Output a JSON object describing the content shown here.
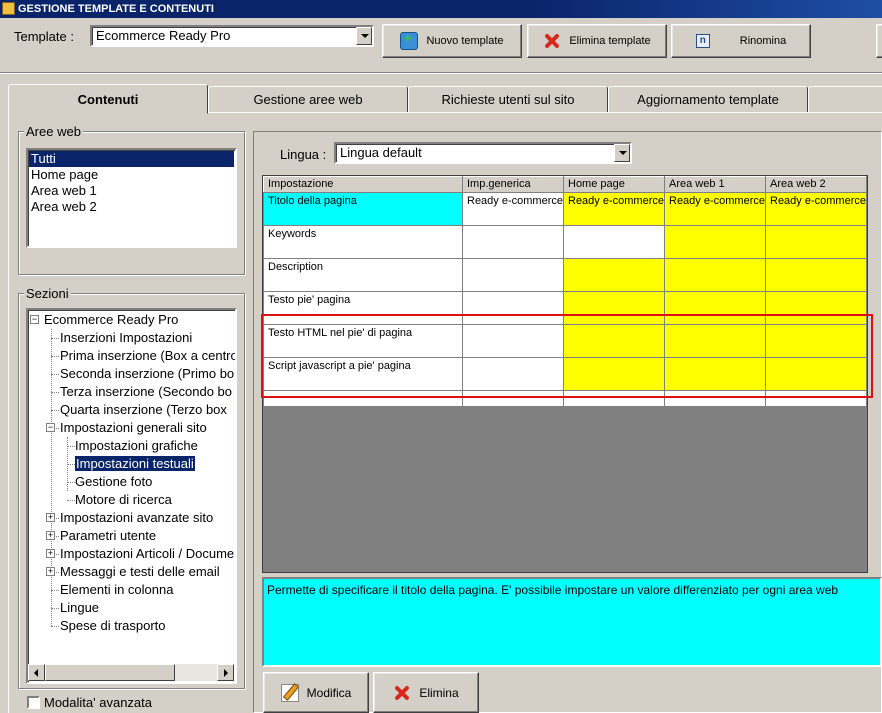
{
  "window": {
    "title": "GESTIONE TEMPLATE E CONTENUTI"
  },
  "toolbar": {
    "template_label": "Template :",
    "template_value": "Ecommerce Ready Pro",
    "new_label": "Nuovo template",
    "delete_label": "Elimina template",
    "rename_label": "Rinomina"
  },
  "tabs": [
    "Contenuti",
    "Gestione aree web",
    "Richieste utenti sul sito",
    "Aggiornamento template"
  ],
  "aree_web": {
    "title": "Aree web",
    "items": [
      "Tutti",
      "Home page",
      "Area web 1",
      "Area web 2"
    ],
    "selected": "Tutti"
  },
  "sezioni": {
    "title": "Sezioni",
    "nodes": [
      {
        "label": "Ecommerce Ready Pro",
        "level": 0,
        "expander": "-"
      },
      {
        "label": "Inserzioni Impostazioni",
        "level": 1
      },
      {
        "label": "Prima inserzione (Box a centro",
        "level": 1
      },
      {
        "label": "Seconda inserzione (Primo bo",
        "level": 1
      },
      {
        "label": "Terza inserzione (Secondo bo",
        "level": 1
      },
      {
        "label": "Quarta inserzione (Terzo box",
        "level": 1
      },
      {
        "label": "Impostazioni generali sito",
        "level": 1,
        "expander": "-"
      },
      {
        "label": "Impostazioni grafiche",
        "level": 2
      },
      {
        "label": "Impostazioni testuali",
        "level": 2,
        "selected": true
      },
      {
        "label": "Gestione foto",
        "level": 2
      },
      {
        "label": "Motore di ricerca",
        "level": 2
      },
      {
        "label": "Impostazioni avanzate sito",
        "level": 1,
        "expander": "+"
      },
      {
        "label": "Parametri utente",
        "level": 1,
        "expander": "+"
      },
      {
        "label": "Impostazioni Articoli / Docume",
        "level": 1,
        "expander": "+"
      },
      {
        "label": "Messaggi e testi delle email",
        "level": 1,
        "expander": "+"
      },
      {
        "label": "Elementi in colonna",
        "level": 1
      },
      {
        "label": "Lingue",
        "level": 1
      },
      {
        "label": "Spese di trasporto",
        "level": 1
      }
    ]
  },
  "advanced_mode_label": "Modalita' avanzata",
  "lingua": {
    "label": "Lingua :",
    "value": "Lingua default"
  },
  "grid": {
    "columns": [
      "Impostazione",
      "Imp.generica",
      "Home page",
      "Area web 1",
      "Area web 2"
    ],
    "rows": [
      {
        "cells": [
          "Titolo della pagina",
          "Ready e-commerce",
          "Ready e-commerce",
          "Ready e-commerce",
          "Ready e-commerce"
        ],
        "colors": [
          "c",
          "w",
          "y",
          "y",
          "y"
        ]
      },
      {
        "cells": [
          "Keywords",
          "",
          "",
          "",
          ""
        ],
        "colors": [
          "w",
          "w",
          "w",
          "y",
          "y"
        ]
      },
      {
        "cells": [
          "Description",
          "",
          "",
          "",
          ""
        ],
        "colors": [
          "w",
          "w",
          "y",
          "y",
          "y"
        ]
      },
      {
        "cells": [
          "Testo pie' pagina",
          "",
          "",
          "",
          ""
        ],
        "colors": [
          "w",
          "w",
          "y",
          "y",
          "y"
        ]
      },
      {
        "cells": [
          "Testo HTML nel pie' di pagina",
          "",
          "",
          "",
          ""
        ],
        "colors": [
          "w",
          "w",
          "y",
          "y",
          "y"
        ]
      },
      {
        "cells": [
          "Script javascript a pie' pagina",
          "",
          "",
          "",
          ""
        ],
        "colors": [
          "w",
          "w",
          "y",
          "y",
          "y"
        ]
      },
      {
        "cells": [
          "",
          "",
          "",
          "",
          ""
        ],
        "colors": [
          "w",
          "w",
          "w",
          "w",
          "w"
        ]
      }
    ]
  },
  "description": "Permette di specificare il titolo della pagina. E' possibile impostare un valore differenziato per ogni area web",
  "bottom": {
    "edit_label": "Modifica",
    "delete_label": "Elimina"
  },
  "colors": {
    "highlight_cyan": "#00ffff",
    "highlight_yellow": "#ffff00",
    "selection": "#0a246a",
    "annotation_red": "#e01010"
  }
}
